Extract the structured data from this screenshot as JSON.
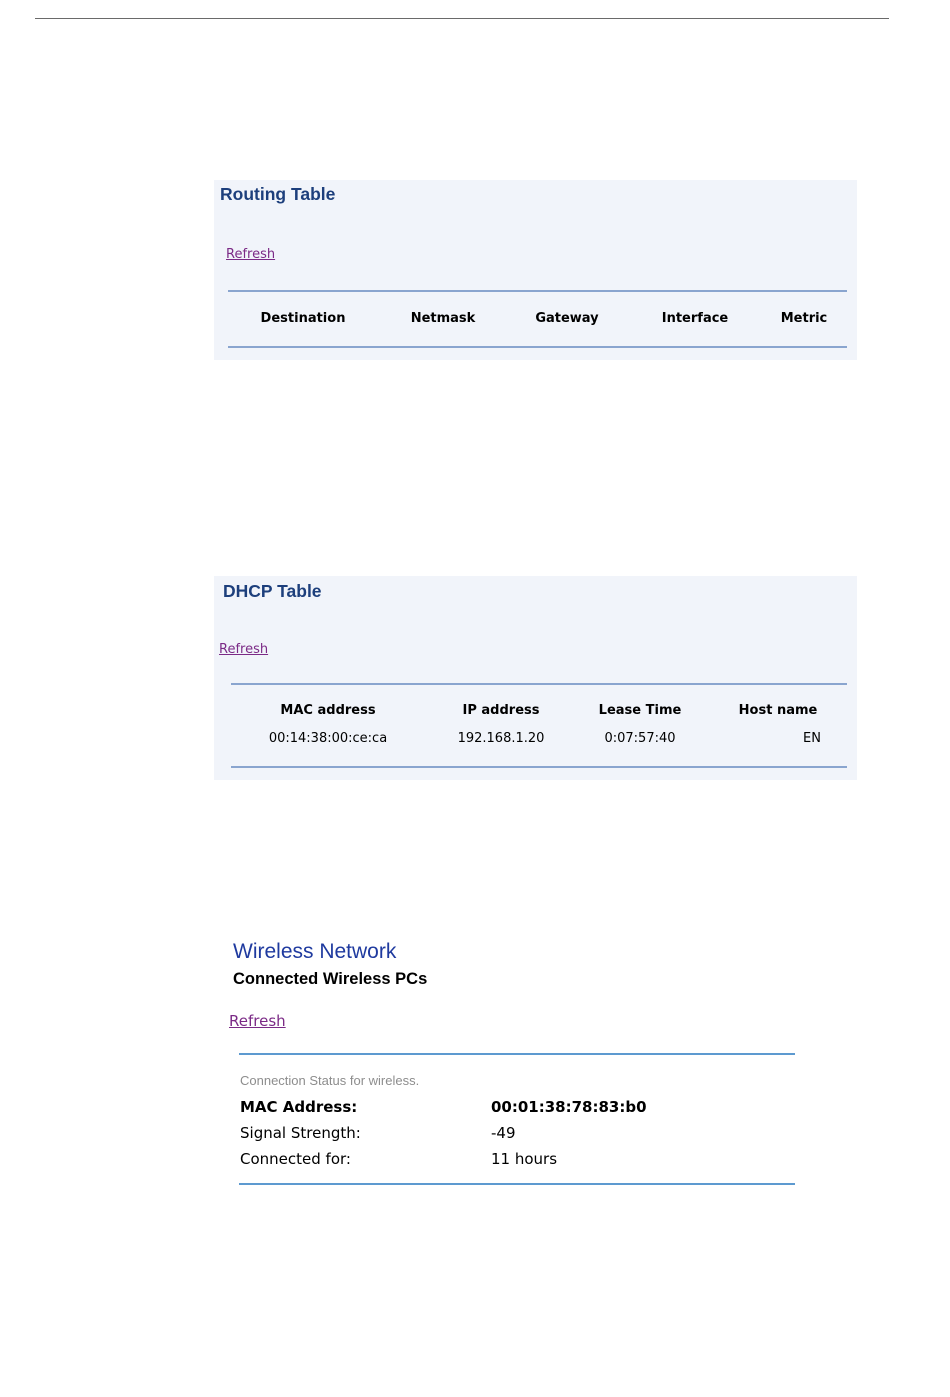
{
  "routing_table": {
    "title": "Routing Table",
    "refresh_label": "Refresh",
    "columns": [
      "Destination",
      "Netmask",
      "Gateway",
      "Interface",
      "Metric"
    ],
    "rows": []
  },
  "dhcp_table": {
    "title": "DHCP Table",
    "refresh_label": "Refresh",
    "columns": [
      "MAC address",
      "IP address",
      "Lease Time",
      "Host name"
    ],
    "rows": [
      [
        "00:14:38:00:ce:ca",
        "192.168.1.20",
        "0:07:57:40",
        "EN"
      ]
    ]
  },
  "wireless": {
    "title": "Wireless Network",
    "subtitle": "Connected Wireless PCs",
    "refresh_label": "Refresh",
    "caption": "Connection Status for wireless.",
    "fields": [
      {
        "label": "MAC Address:",
        "value": "00:01:38:78:83:b0"
      },
      {
        "label": "Signal Strength:",
        "value": "-49"
      },
      {
        "label": "Connected for:",
        "value": "11 hours"
      }
    ]
  },
  "colors": {
    "panel_bg": "#f1f4fa",
    "title_blue": "#1d3f7c",
    "link_purple": "#7b2a86",
    "rule_blue": "#8aa5cf"
  }
}
